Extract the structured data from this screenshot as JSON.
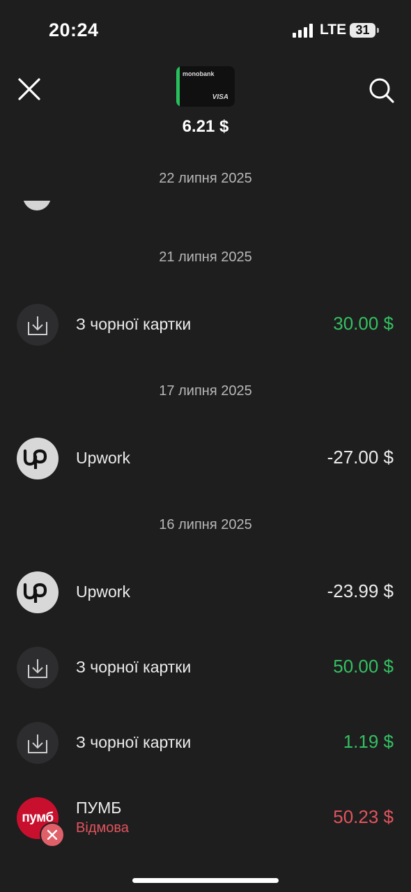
{
  "status_bar": {
    "time": "20:24",
    "network": "LTE",
    "battery": "31"
  },
  "header": {
    "card": {
      "brand": "monobank",
      "network_logo": "VISA",
      "accent_color": "#27c05c"
    },
    "balance": "6.21 $",
    "close_icon": "close-icon",
    "search_icon": "search-icon"
  },
  "transactions": {
    "groups": [
      {
        "date": "22 липня 2025",
        "items": []
      },
      {
        "date": "21 липня 2025",
        "items": [
          {
            "title": "З чорної картки",
            "amount": "30.00 $",
            "icon": "download-icon"
          }
        ]
      },
      {
        "date": "17 липня 2025",
        "items": [
          {
            "title": "Upwork",
            "amount": "-27.00 $",
            "icon": "upwork-logo"
          }
        ]
      },
      {
        "date": "16 липня 2025",
        "items": [
          {
            "title": "Upwork",
            "amount": "-23.99 $",
            "icon": "upwork-logo"
          },
          {
            "title": "З чорної картки",
            "amount": "50.00 $",
            "icon": "download-icon"
          },
          {
            "title": "З чорної картки",
            "amount": "1.19 $",
            "icon": "download-icon"
          },
          {
            "title": "ПУМБ",
            "subtitle": "Відмова",
            "amount": "50.23 $",
            "icon": "pumb-logo",
            "logo_text": "пумб"
          }
        ]
      }
    ]
  },
  "colors": {
    "positive": "#34c060",
    "declined": "#e2545c",
    "background": "#1e1e1f"
  }
}
